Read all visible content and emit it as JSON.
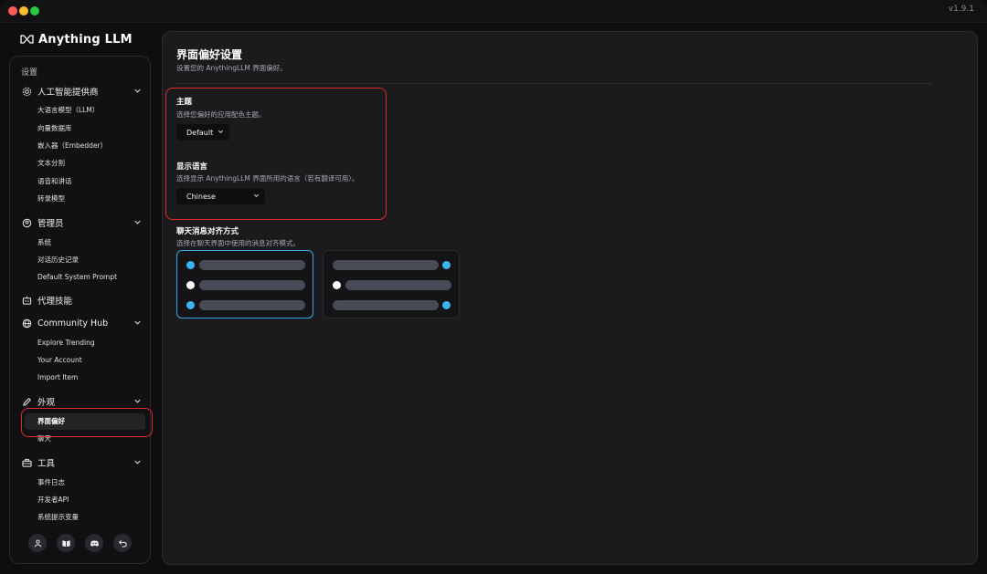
{
  "app": {
    "version": "v1.9.1",
    "brand": "Anything LLM"
  },
  "sidebar": {
    "heading": "设置",
    "groups": {
      "ai": {
        "label": "人工智能提供商",
        "items": [
          "大语言模型（LLM）",
          "向量数据库",
          "嵌入器（Embedder）",
          "文本分割",
          "语音和讲话",
          "转录模型"
        ]
      },
      "admin": {
        "label": "管理员",
        "items": [
          "系统",
          "对话历史记录",
          "Default System Prompt"
        ]
      },
      "agent": {
        "label": "代理技能"
      },
      "hub": {
        "label": "Community Hub",
        "items": [
          "Explore Trending",
          "Your Account",
          "Import Item"
        ]
      },
      "appearance": {
        "label": "外观",
        "items": [
          "界面偏好",
          "聊天"
        ]
      },
      "tools": {
        "label": "工具",
        "items": [
          "事件日志",
          "开发者API",
          "系统提示变量"
        ]
      }
    },
    "footer_icons": [
      "community-icon",
      "docs-book-icon",
      "discord-icon",
      "back-arrow-icon"
    ]
  },
  "main": {
    "title": "界面偏好设置",
    "subtitle": "设置您的 AnythingLLM 界面偏好。",
    "theme": {
      "title": "主题",
      "desc": "选择您偏好的应用配色主题。",
      "value": "Default"
    },
    "language": {
      "title": "显示语言",
      "desc": "选择显示 AnythingLLM 界面所用的语言（若有翻译可用）。",
      "value": "Chinese"
    },
    "alignment": {
      "title": "聊天消息对齐方式",
      "desc": "选择在聊天界面中使用的消息对齐模式。",
      "selected": "left"
    }
  },
  "colors": {
    "accent": "#3aa6e0",
    "highlight": "#e02b2b",
    "panel": "#1b1b1e"
  }
}
